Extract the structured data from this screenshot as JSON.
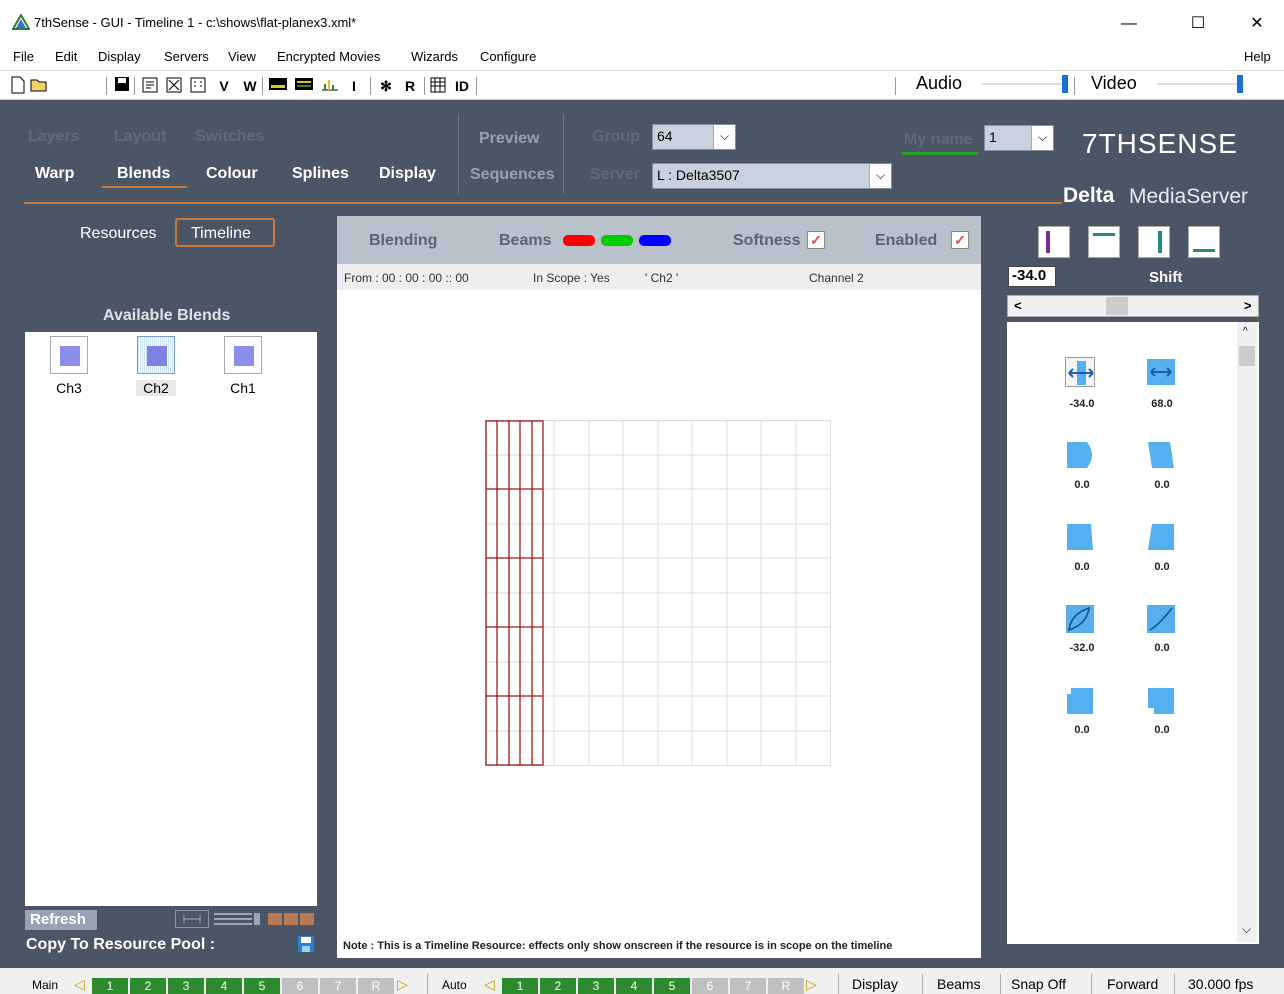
{
  "window": {
    "title": "7thSense -  GUI  - Timeline 1  - c:\\shows\\flat-planex3.xml*",
    "minimize": "—",
    "maximize": "☐",
    "close": "✕"
  },
  "menu": {
    "file": "File",
    "edit": "Edit",
    "display": "Display",
    "servers": "Servers",
    "view": "View",
    "encrypted": "Encrypted Movies",
    "wizards": "Wizards",
    "configure": "Configure",
    "help": "Help"
  },
  "toolbar": {
    "v": "V",
    "w": "W",
    "i": "I",
    "r": "R",
    "id": "ID",
    "audio": "Audio",
    "video": "Video",
    "audio_level": 1.0,
    "video_level": 1.0
  },
  "nav": {
    "layers": "Layers",
    "layout": "Layout",
    "switches": "Switches",
    "warp": "Warp",
    "blends": "Blends",
    "colour": "Colour",
    "splines": "Splines",
    "display": "Display",
    "preview": "Preview",
    "sequences": "Sequences",
    "group_label": "Group",
    "group_value": "64",
    "server_label": "Server",
    "server_value": "L : Delta3507",
    "myname_label": "My name",
    "myname_value": "1",
    "brand": "7THSENSE",
    "product_bold": "Delta",
    "product": "MediaServer"
  },
  "left": {
    "resources": "Resources",
    "timeline": "Timeline",
    "available": "Available Blends",
    "blends": [
      "Ch3",
      "Ch2",
      "Ch1"
    ],
    "refresh": "Refresh",
    "copy": "Copy To Resource Pool :"
  },
  "center": {
    "blending": "Blending",
    "beams": "Beams",
    "softness": "Softness",
    "enabled": "Enabled",
    "check": "✓",
    "from": "From : 00 : 00 : 00 :: 00",
    "inscope": "In Scope : Yes",
    "channel_id": "' Ch2 '",
    "channel": "Channel 2",
    "note": "Note : This is a Timeline Resource: effects only show onscreen if the resource is in scope on the timeline",
    "beam_colors": [
      "#ff0000",
      "#00cc00",
      "#0000ff"
    ]
  },
  "right": {
    "shift_value": "-34.0",
    "shift_label": "Shift",
    "scroll_left": "<",
    "scroll_right": ">",
    "values": [
      [
        "-34.0",
        "68.0"
      ],
      [
        "0.0",
        "0.0"
      ],
      [
        "0.0",
        "0.0"
      ],
      [
        "-32.0",
        "0.0"
      ],
      [
        "0.0",
        "0.0"
      ]
    ]
  },
  "status": {
    "main": "Main",
    "auto": "Auto",
    "nums": [
      "1",
      "2",
      "3",
      "4",
      "5",
      "6",
      "7",
      "R"
    ],
    "display": "Display",
    "beams": "Beams",
    "snap": "Snap Off",
    "forward": "Forward",
    "fps": "30.000 fps",
    "left_arrow": "◁",
    "right_arrow": "▷"
  }
}
